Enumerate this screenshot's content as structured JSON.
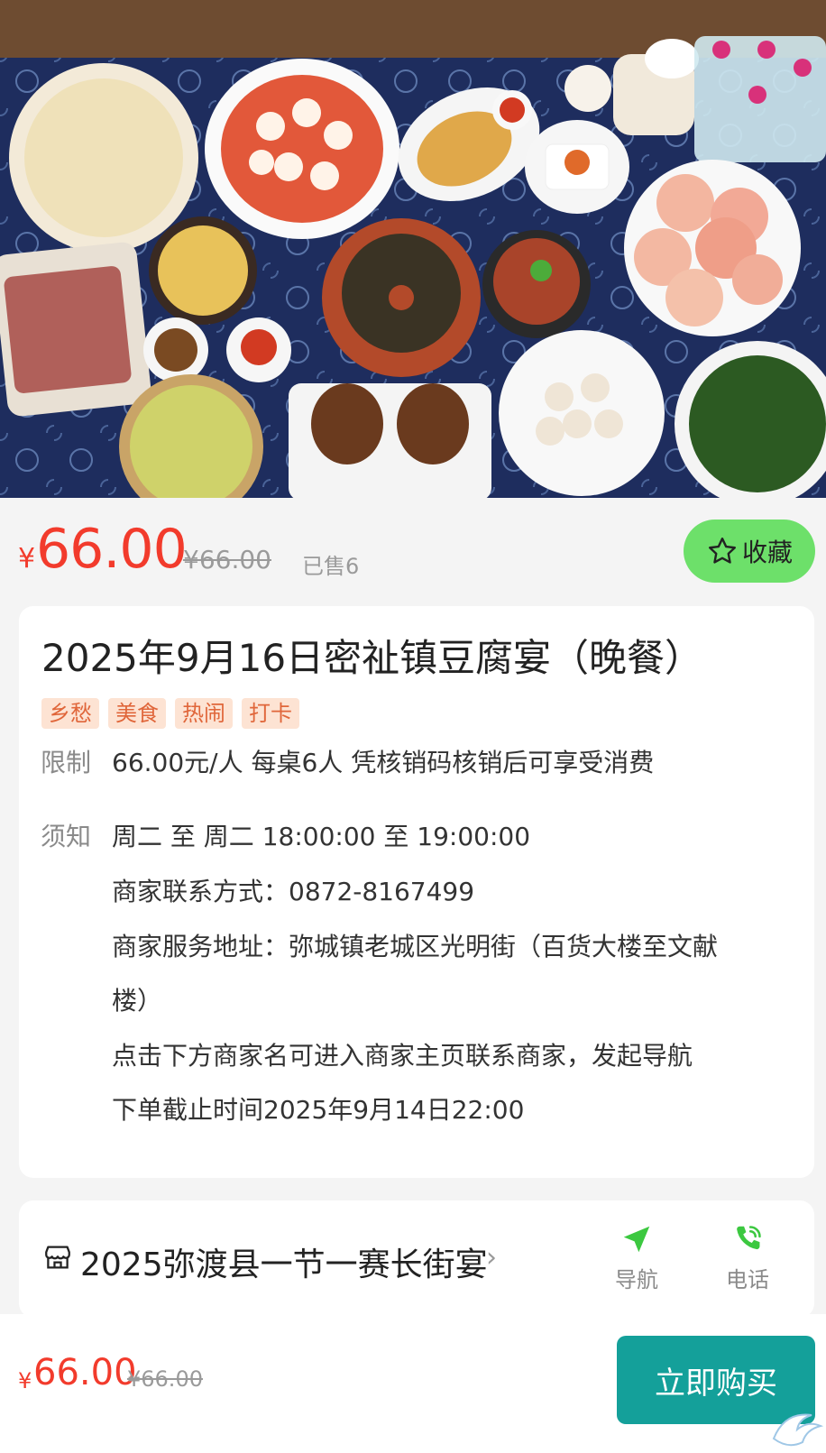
{
  "product": {
    "currency": "¥",
    "price": "66.00",
    "original_price": "¥66.00",
    "sold": "已售6",
    "favorite_label": "收藏",
    "title": "2025年9月16日密祉镇豆腐宴（晚餐）",
    "tags": [
      "乡愁",
      "美食",
      "热闹",
      "打卡"
    ]
  },
  "info": {
    "limit_label": "限制",
    "limit_text": "66.00元/人 每桌6人 凭核销码核销后可享受消费",
    "notice_label": "须知",
    "notice_lines": [
      "周二 至 周二 18:00:00 至 19:00:00",
      "商家联系方式：0872-8167499",
      "商家服务地址：弥城镇老城区光明街（百货大楼至文献",
      "楼）",
      "点击下方商家名可进入商家主页联系商家，发起导航",
      "下单截止时间2025年9月14日22:00"
    ]
  },
  "merchant": {
    "name": "2025弥渡县一节一赛长街宴",
    "nav_label": "导航",
    "phone_label": "电话"
  },
  "bottom": {
    "currency": "¥",
    "price": "66.00",
    "original_price": "¥66.00",
    "buy_label": "立即购买"
  },
  "colors": {
    "price_red": "#f23b2c",
    "favorite_green": "#6de06a",
    "buy_teal": "#14a09a",
    "tag_orange": "#e0663a",
    "icon_green": "#3cc840"
  }
}
